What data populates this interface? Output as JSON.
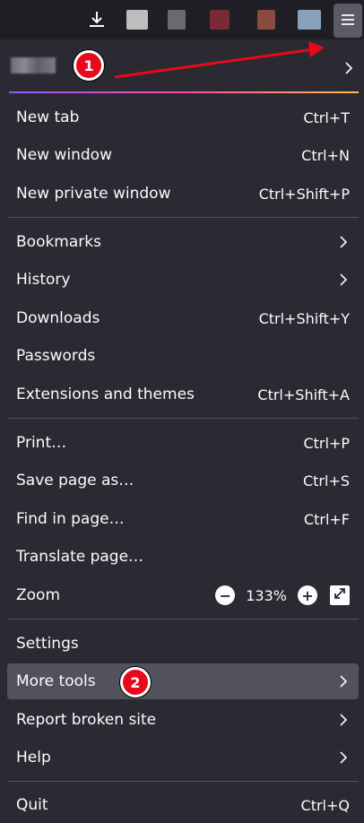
{
  "toolbar": {
    "download_icon": "download-icon",
    "menu_icon": "hamburger-menu-icon"
  },
  "account": {
    "chevron_icon": "chevron-right-icon"
  },
  "menu": {
    "new_tab": {
      "label": "New tab",
      "shortcut": "Ctrl+T"
    },
    "new_window": {
      "label": "New window",
      "shortcut": "Ctrl+N"
    },
    "new_private_window": {
      "label": "New private window",
      "shortcut": "Ctrl+Shift+P"
    },
    "bookmarks": {
      "label": "Bookmarks"
    },
    "history": {
      "label": "History"
    },
    "downloads": {
      "label": "Downloads",
      "shortcut": "Ctrl+Shift+Y"
    },
    "passwords": {
      "label": "Passwords"
    },
    "extensions": {
      "label": "Extensions and themes",
      "shortcut": "Ctrl+Shift+A"
    },
    "print": {
      "label": "Print…",
      "shortcut": "Ctrl+P"
    },
    "save_page": {
      "label": "Save page as…",
      "shortcut": "Ctrl+S"
    },
    "find": {
      "label": "Find in page…",
      "shortcut": "Ctrl+F"
    },
    "translate": {
      "label": "Translate page…"
    },
    "zoom": {
      "label": "Zoom",
      "value": "133%",
      "minus": "−",
      "plus": "+"
    },
    "settings": {
      "label": "Settings"
    },
    "more_tools": {
      "label": "More tools"
    },
    "report": {
      "label": "Report broken site"
    },
    "help": {
      "label": "Help"
    },
    "quit": {
      "label": "Quit",
      "shortcut": "Ctrl+Q"
    }
  },
  "annotations": {
    "badge1": "1",
    "badge2": "2",
    "color": "#e8091b"
  }
}
